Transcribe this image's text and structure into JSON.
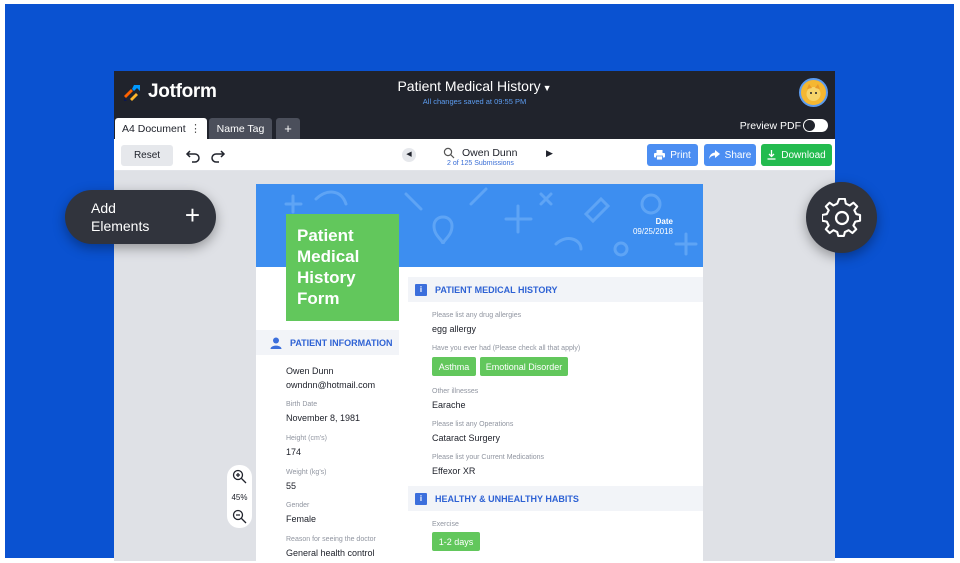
{
  "app": {
    "logo_text": "Jotform",
    "document_title": "Patient Medical History",
    "save_status": "All changes saved at 09:55 PM",
    "avatar_icon": "user-avatar-icon"
  },
  "tabs": [
    {
      "label": "A4 Document",
      "active": true
    },
    {
      "label": "Name Tag",
      "active": false
    },
    {
      "label": "+",
      "active": false
    }
  ],
  "preview_pdf": {
    "label": "Preview PDF",
    "enabled": false
  },
  "toolbar": {
    "reset_label": "Reset",
    "submission_name": "Owen Dunn",
    "submission_count": "2 of 125 Submissions",
    "print_label": "Print",
    "share_label": "Share",
    "download_label": "Download"
  },
  "document": {
    "title": "Patient Medical History Form",
    "date_label": "Date",
    "date_value": "09/25/2018",
    "patient_info": {
      "section_title": "PATIENT INFORMATION",
      "name": "Owen Dunn",
      "email": "owndnn@hotmail.com",
      "fields": [
        {
          "label": "Birth Date",
          "value": "November 8, 1981"
        },
        {
          "label": "Height (cm's)",
          "value": "174"
        },
        {
          "label": "Weight (kg's)",
          "value": "55"
        },
        {
          "label": "Gender",
          "value": "Female"
        },
        {
          "label": "Reason for seeing the doctor",
          "value": "General health control"
        }
      ]
    },
    "medical_history": {
      "section_title": "PATIENT MEDICAL HISTORY",
      "allergies_label": "Please list any drug allergies",
      "allergies_value": "egg allergy",
      "had_label": "Have you ever had (Please check all that apply)",
      "had_values": [
        "Asthma",
        "Emotional Disorder"
      ],
      "other_label": "Other illnesses",
      "other_value": "Earache",
      "operations_label": "Please list any Operations",
      "operations_value": "Cataract Surgery",
      "medications_label": "Please list your Current Medications",
      "medications_value": "Effexor XR"
    },
    "habits": {
      "section_title": "HEALTHY & UNHEALTHY HABITS",
      "exercise_label": "Exercise",
      "exercise_value": "1-2 days"
    }
  },
  "overlay": {
    "add_elements_label": "Add Elements",
    "add_icon": "plus-icon",
    "settings_icon": "gear-icon"
  },
  "zoom": {
    "value": "45%"
  },
  "colors": {
    "background": "#0a52d1",
    "topbar": "#20232c",
    "accent_blue": "#4c8ef2",
    "download_green": "#23bb4f",
    "form_green": "#62c75c",
    "section_title": "#2e62d4"
  }
}
